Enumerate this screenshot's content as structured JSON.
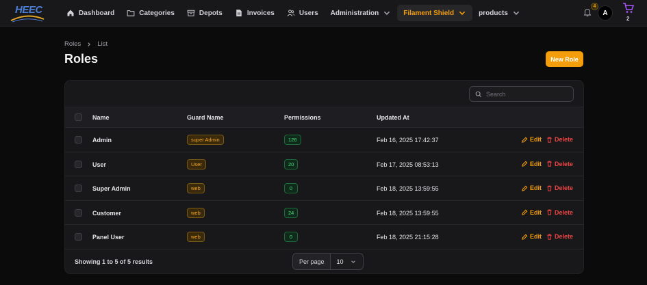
{
  "header": {
    "logo": "HEEC",
    "nav": [
      {
        "label": "Dashboard",
        "icon": "home-icon"
      },
      {
        "label": "Categories",
        "icon": "folder-icon"
      },
      {
        "label": "Depots",
        "icon": "archive-icon"
      },
      {
        "label": "Invoices",
        "icon": "document-icon"
      },
      {
        "label": "Users",
        "icon": "users-icon"
      },
      {
        "label": "Administration",
        "icon": "chevron-down-icon"
      },
      {
        "label": "Filament Shield",
        "icon": "chevron-down-icon"
      },
      {
        "label": "products",
        "icon": "chevron-down-icon"
      }
    ],
    "notification_count": "4",
    "avatar_initial": "A",
    "cart_count": "2"
  },
  "breadcrumb": [
    "Roles",
    "List"
  ],
  "page_title": "Roles",
  "new_button": "New Role",
  "search": {
    "placeholder": "Search"
  },
  "table": {
    "columns": [
      "Name",
      "Guard Name",
      "Permissions",
      "Updated At"
    ],
    "rows": [
      {
        "name": "Admin",
        "guard": "super Admin",
        "permissions": "126",
        "updated": "Feb 16, 2025 17:42:37"
      },
      {
        "name": "User",
        "guard": "User",
        "permissions": "20",
        "updated": "Feb 17, 2025 08:53:13"
      },
      {
        "name": "Super Admin",
        "guard": "web",
        "permissions": "0",
        "updated": "Feb 18, 2025 13:59:55"
      },
      {
        "name": "Customer",
        "guard": "web",
        "permissions": "24",
        "updated": "Feb 18, 2025 13:59:55"
      },
      {
        "name": "Panel User",
        "guard": "web",
        "permissions": "0",
        "updated": "Feb 18, 2025 21:15:28"
      }
    ],
    "edit_label": "Edit",
    "delete_label": "Delete"
  },
  "footer": {
    "results": "Showing 1 to 5 of 5 results",
    "per_page_label": "Per page",
    "per_page_value": "10"
  },
  "colors": {
    "accent": "#f59e0b",
    "danger": "#ef4444",
    "success": "#4ade80",
    "cart": "#a855f7"
  }
}
